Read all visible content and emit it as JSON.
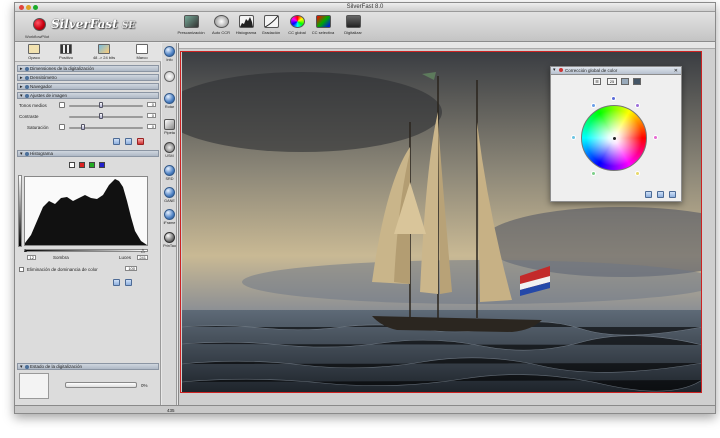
{
  "app": {
    "title": "SilverFast 8.0",
    "logo": "SilverFast",
    "logo_edition": "SE",
    "logo_caption": "WorkflowPilot"
  },
  "colors": {
    "frame_red": "#cc2222",
    "accent_blue": "#4f82c4"
  },
  "toolbar": {
    "items": [
      {
        "label": "Prescanización",
        "icon": "prescan-icon"
      },
      {
        "label": "Auto CCR",
        "icon": "auto-ccr-icon"
      },
      {
        "label": "Histograma",
        "icon": "histogram-icon"
      },
      {
        "label": "Gradación",
        "icon": "gradation-icon"
      },
      {
        "label": "CC global",
        "icon": "cc-global-icon"
      },
      {
        "label": "CC selectiva",
        "icon": "cc-selective-icon"
      },
      {
        "label": "Digitalizar",
        "icon": "scan-icon"
      }
    ]
  },
  "scan_modes": [
    {
      "label": "Opaco",
      "icon": "reflective-icon"
    },
    {
      "label": "Positivo",
      "icon": "positive-film-icon"
    },
    {
      "label": "48 -> 24 bits",
      "icon": "bit-depth-icon"
    },
    {
      "label": "Marco",
      "icon": "frame-icon"
    }
  ],
  "sections": {
    "scan_dimensions": "Dimensiones de la digitalización",
    "densitometer": "Densitómetro",
    "navigator": "Navegador",
    "image_adjust": "Ajustes de imagen",
    "histogram": "Histograma",
    "scan_status": "Estado de la digitalización"
  },
  "adjustments": {
    "midtones": {
      "label": "Tonos medios",
      "value": "0"
    },
    "contrast": {
      "label": "Contraste",
      "value": "0"
    },
    "saturation": {
      "label": "Saturación",
      "value": "0"
    }
  },
  "histogram": {
    "shadow_label": "Sombra",
    "shadow_value": "12",
    "lights_label": "Luces",
    "lights_value": "241",
    "cast_label": "Eliminación de dominancia de color",
    "cast_value": "100"
  },
  "scan_status": {
    "percent": "0%"
  },
  "tools": [
    {
      "label": "Info",
      "icon": "info-icon"
    },
    {
      "label": "",
      "icon": "zoom-icon"
    },
    {
      "label": "Rotar",
      "icon": "rotate-icon"
    },
    {
      "label": "Pipeta",
      "icon": "eyedropper-icon"
    },
    {
      "label": "USM",
      "icon": "usm-icon"
    },
    {
      "label": "SRD",
      "icon": "srd-icon"
    },
    {
      "label": "GANE",
      "icon": "gane-icon"
    },
    {
      "label": "iFrame",
      "icon": "iframe-icon"
    },
    {
      "label": "PrinTao",
      "icon": "printao-icon"
    }
  ],
  "status_bar": {
    "value": "435"
  },
  "color_panel": {
    "title": "Corrección global de color",
    "field_value": "25"
  }
}
